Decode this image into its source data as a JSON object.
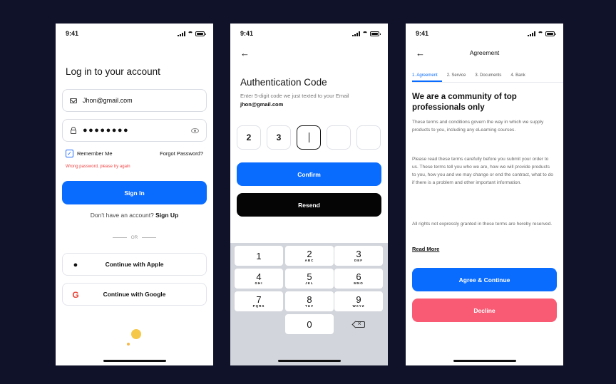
{
  "status_time": "9:41",
  "login": {
    "title": "Log in to your account",
    "email_value": "Jhon@gmail.com",
    "password_mask": "●●●●●●●●",
    "remember_label": "Remember Me",
    "remember_checked": true,
    "forgot_label": "Forgot Password?",
    "error": "Wrong password, please try again",
    "sign_in_label": "Sign In",
    "no_account_text": "Don't have an account?",
    "sign_up_label": "Sign Up",
    "or_text": "OR",
    "apple_label": "Continue with Apple",
    "google_label": "Continue with Google",
    "icons": [
      "mail-icon",
      "lock-icon",
      "eye-icon",
      "apple-icon",
      "google-icon"
    ]
  },
  "auth": {
    "title": "Authentication Code",
    "subtitle": "Enter 5-digit code we just texted to your Email",
    "email": "jhon@gmail.com",
    "digits": [
      "2",
      "3",
      "",
      "",
      ""
    ],
    "active_index": 2,
    "confirm_label": "Confirm",
    "resend_label": "Resend",
    "keys": [
      {
        "n": "1",
        "l": ""
      },
      {
        "n": "2",
        "l": "ABC"
      },
      {
        "n": "3",
        "l": "DEF"
      },
      {
        "n": "4",
        "l": "GHI"
      },
      {
        "n": "5",
        "l": "JKL"
      },
      {
        "n": "6",
        "l": "MNO"
      },
      {
        "n": "7",
        "l": "PQRS"
      },
      {
        "n": "8",
        "l": "TUV"
      },
      {
        "n": "9",
        "l": "WXYZ"
      },
      {
        "n": "0",
        "l": ""
      }
    ]
  },
  "agreement": {
    "header": "Agreement",
    "tabs": [
      "1. Agreement",
      "2. Service",
      "3. Documents",
      "4. Bank"
    ],
    "active_tab": 0,
    "title": "We are a community of top professionals only",
    "p1": "These terms and conditions govern the way in which we supply products to you, including any eLearning courses.",
    "p2": "Please read these terms carefully before you submit your order to us. These terms tell you who we are, how we will provide products to you, how you and we may change or end the contract, what to do if there is a problem and other important information.",
    "p3": "All rights not expressly granted in these terms are hereby reserved.",
    "read_more": "Read More",
    "agree_label": "Agree & Continue",
    "decline_label": "Decline"
  },
  "colors": {
    "background": "#0f1229",
    "primary": "#0a6cff",
    "danger": "#f95b74",
    "error": "#ef4444",
    "accent_dot": "#f6c84a"
  }
}
